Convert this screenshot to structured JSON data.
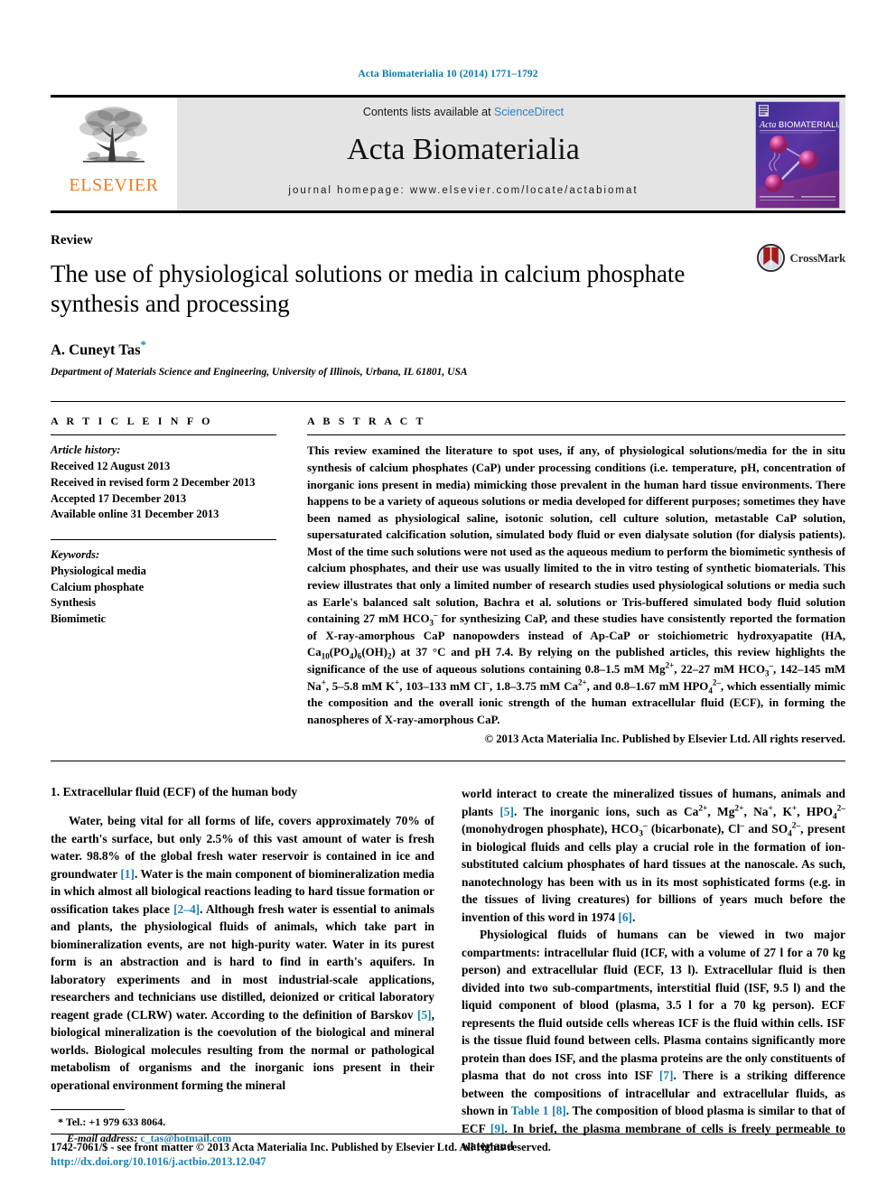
{
  "running_head": "Acta Biomaterialia 10 (2014) 1771–1792",
  "masthead": {
    "publisher_name": "ELSEVIER",
    "contents_prefix": "Contents lists available at ",
    "contents_link": "ScienceDirect",
    "journal_title": "Acta Biomaterialia",
    "homepage_label": "journal homepage: www.elsevier.com/locate/actabiomat",
    "cover_title": "Acta BIOMATERIALIA"
  },
  "title_block": {
    "doctype": "Review",
    "title": "The use of physiological solutions or media in calcium phosphate synthesis and processing",
    "author": "A. Cuneyt Tas",
    "author_marker": "*",
    "affiliation": "Department of Materials Science and Engineering, University of Illinois, Urbana, IL 61801, USA",
    "crossmark_label": "CrossMark"
  },
  "article_info": {
    "heading": "A R T I C L E   I N F O",
    "history_heading": "Article history:",
    "history": [
      "Received 12 August 2013",
      "Received in revised form 2 December 2013",
      "Accepted 17 December 2013",
      "Available online 31 December 2013"
    ],
    "keywords_heading": "Keywords:",
    "keywords": [
      "Physiological media",
      "Calcium phosphate",
      "Synthesis",
      "Biomimetic"
    ]
  },
  "abstract": {
    "heading": "A B S T R A C T",
    "paragraph_1": "This review examined the literature to spot uses, if any, of physiological solutions/media for the in situ synthesis of calcium phosphates (CaP) under processing conditions (i.e. temperature, pH, concentration of inorganic ions present in media) mimicking those prevalent in the human hard tissue environments. There happens to be a variety of aqueous solutions or media developed for different purposes; sometimes they have been named as physiological saline, isotonic solution, cell culture solution, metastable CaP solution, supersaturated calcification solution, simulated body fluid or even dialysate solution (for dialysis patients). Most of the time such solutions were not used as the aqueous medium to perform the biomimetic synthesis of calcium phosphates, and their use was usually limited to the in vitro testing of synthetic biomaterials. This review illustrates that only a limited number of research studies used physiological solutions or media such as Earle's balanced salt solution, Bachra et al. solutions or Tris-buffered simulated body fluid solution containing 27 mM HCO",
    "frag_hco3_sub": "3",
    "frag_hco3_sup": "–",
    "paragraph_1b": " for synthesizing CaP, and these studies have consistently reported the formation of X-ray-amorphous CaP nanopowders instead of Ap-CaP or stoichiometric hydroxyapatite (HA, Ca",
    "ha_ca_sub": "10",
    "ha_po4": "(PO",
    "ha_po4_sub": "4",
    "ha_po4_close": ")",
    "ha_po4_count": "6",
    "ha_oh": "(OH)",
    "ha_oh_sub": "2",
    "paragraph_1c": ") at 37 °C and pH 7.4. By relying on the published articles, this review highlights the significance of the use of aqueous solutions containing 0.8–1.5 mM Mg",
    "mg_sup": "2+",
    "paragraph_1d": ", 22–27 mM  HCO",
    "hco3b_sub": "3",
    "hco3b_sup": "–",
    "paragraph_1e": ",  142–145 mM  Na",
    "na_sup": "+",
    "paragraph_1f": ",  5–5.8 mM  K",
    "k_sup": "+",
    "paragraph_1g": ",  103–133 mM  Cl",
    "cl_sup": "–",
    "paragraph_1h": ",  1.8–3.75 mM  Ca",
    "ca_sup": "2+",
    "paragraph_1i": ", and 0.8–1.67 mM HPO",
    "hpo4_sub": "4",
    "hpo4_sup": "2–",
    "paragraph_1j": ", which essentially mimic the composition and the overall ionic strength of the human extracellular fluid (ECF), in forming the nanospheres of X-ray-amorphous CaP.",
    "copyright": "© 2013 Acta Materialia Inc. Published by Elsevier Ltd. All rights reserved."
  },
  "body": {
    "section_heading": "1. Extracellular fluid (ECF) of the human body",
    "left_p1_a": "Water, being vital for all forms of life, covers approximately 70% of the earth's surface, but only 2.5% of this vast amount of water is fresh water. 98.8% of the global fresh water reservoir is contained in ice and groundwater ",
    "left_p1_ref1": "[1]",
    "left_p1_b": ". Water is the main component of biomineralization media in which almost all biological reactions leading to hard tissue formation or ossification takes place ",
    "left_p1_ref2": "[2–4]",
    "left_p1_c": ". Although fresh water is essential to animals and plants, the physiological fluids of animals, which take part in biomineralization events, are not high-purity water. Water in its purest form is an abstraction and is hard to find in earth's aquifers. In laboratory experiments and in most industrial-scale applications, researchers and technicians use distilled, deionized or critical laboratory reagent grade (CLRW) water. According to the definition of Barskov ",
    "left_p1_ref3": "[5]",
    "left_p1_d": ", biological mineralization is the coevolution of the biological and mineral worlds. Biological molecules resulting from the normal or pathological metabolism of organisms and the inorganic ions present in their operational environment forming the mineral",
    "right_p1_a": "world interact to create the mineralized tissues of humans, animals and plants ",
    "right_p1_ref1": "[5]",
    "right_p1_b": ". The inorganic ions, such as Ca",
    "right_ca_sup": "2+",
    "right_p1_c": ", Mg",
    "right_mg_sup": "2+",
    "right_p1_d": ", Na",
    "right_na_sup": "+",
    "right_p1_e": ", K",
    "right_k_sup": "+",
    "right_p1_f": ", HPO",
    "right_hpo4_sub": "4",
    "right_hpo4_sup": "2–",
    "right_p1_g": " (monohydrogen phosphate), HCO",
    "right_hco3_sub": "3",
    "right_hco3_sup": "–",
    "right_p1_h": " (bicarbonate), Cl",
    "right_cl_sup": "–",
    "right_p1_i": " and SO",
    "right_so4_sub": "4",
    "right_so4_sup": "2–",
    "right_p1_j": ", present in biological fluids and cells play a crucial role in the formation of ion-substituted calcium phosphates of hard tissues at the nanoscale. As such, nanotechnology has been with us in its most sophisticated forms (e.g. in the tissues of living creatures) for billions of years much before the invention of this word in 1974 ",
    "right_p1_ref2": "[6]",
    "right_p1_k": ".",
    "right_p2_a": "Physiological fluids of humans can be viewed in two major compartments: intracellular fluid (ICF, with a volume of 27 l for a 70 kg person) and extracellular fluid (ECF, 13 l). Extracellular fluid is then divided into two sub-compartments, interstitial fluid (ISF, 9.5 l) and the liquid component of blood (plasma, 3.5 l for a 70 kg person). ECF represents the fluid outside cells whereas ICF is the fluid within cells. ISF is the tissue fluid found between cells. Plasma contains significantly more protein than does ISF, and the plasma proteins are the only constituents of plasma that do not cross into ISF ",
    "right_p2_ref1": "[7]",
    "right_p2_b": ". There is a striking difference between the compositions of intracellular and extracellular fluids, as shown in ",
    "right_p2_tableref": "Table 1 [8]",
    "right_p2_c": ". The composition of blood plasma is similar to that of ECF ",
    "right_p2_ref2": "[9]",
    "right_p2_d": ". In brief, the plasma membrane of cells is freely permeable to water and"
  },
  "footnote": {
    "marker": "*",
    "tel": "Tel.: +1 979 633 8064.",
    "email_label": "E-mail address:",
    "email": "c_tas@hotmail.com"
  },
  "page_footer": {
    "line1": "1742-7061/$ - see front matter © 2013 Acta Materialia Inc. Published by Elsevier Ltd. All rights reserved.",
    "line2": "http://dx.doi.org/10.1016/j.actbio.2013.12.047"
  },
  "colors": {
    "link_blue": "#1b7fb0",
    "sciencedirect_blue": "#2a7fc9",
    "elsevier_orange": "#f47c20",
    "band_gray": "#e4e4e4"
  }
}
